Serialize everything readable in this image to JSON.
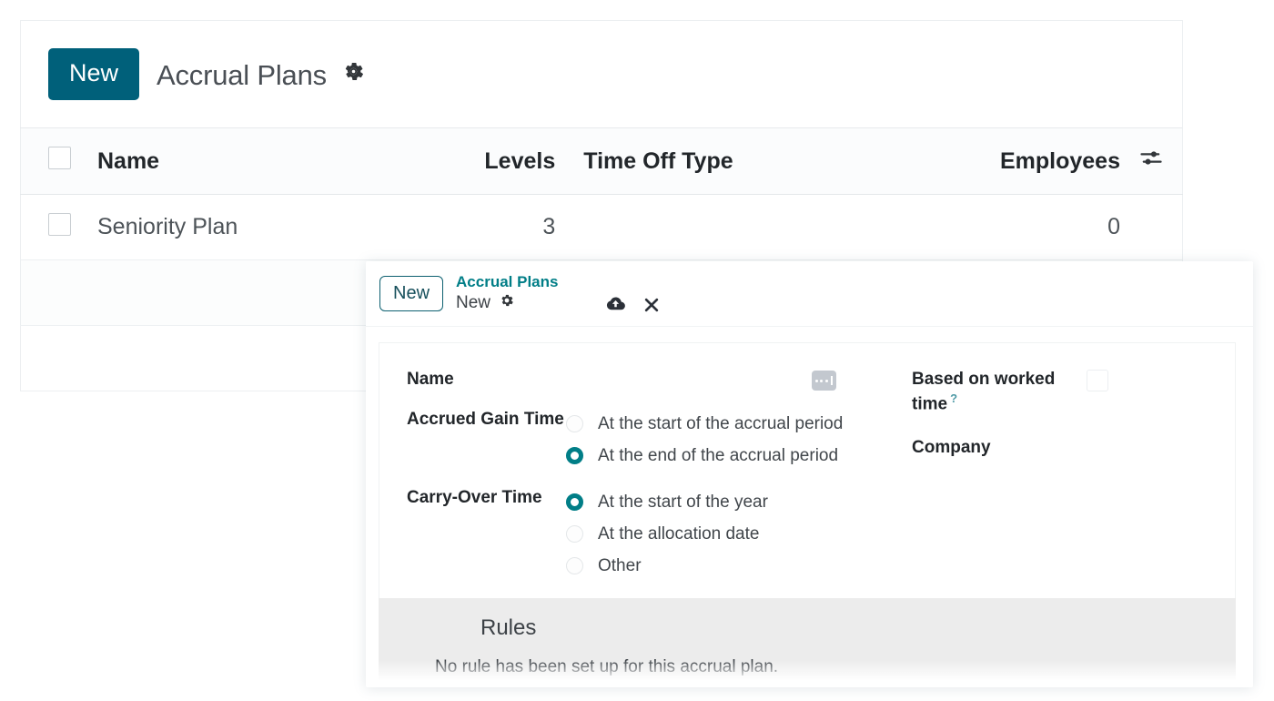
{
  "list_view": {
    "new_button_label": "New",
    "page_title": "Accrual Plans",
    "title_gear_icon": "gear-icon",
    "table": {
      "columns": [
        "Name",
        "Levels",
        "Time Off Type",
        "Employees"
      ],
      "settings_icon": "sliders-icon",
      "rows": [
        {
          "name": "Seniority Plan",
          "levels": "3",
          "time_off_type": "",
          "employees": "0"
        },
        {
          "name": "",
          "levels": "",
          "time_off_type": "",
          "employees": ""
        },
        {
          "name": "",
          "levels": "",
          "time_off_type": "",
          "employees": ""
        }
      ]
    }
  },
  "dialog": {
    "new_button_label": "New",
    "breadcrumb_root": "Accrual Plans",
    "breadcrumb_current": "New",
    "breadcrumb_gear_icon": "gear-icon",
    "save_icon": "cloud-upload-icon",
    "discard_icon": "close-icon",
    "form": {
      "name_label": "Name",
      "name_value": "",
      "name_placeholder_icon": "dots-placeholder-icon",
      "accrued_gain_time_label": "Accrued Gain Time",
      "accrued_gain_options": [
        {
          "label": "At the start of the accrual period",
          "selected": false
        },
        {
          "label": "At the end of the accrual period",
          "selected": true
        }
      ],
      "carry_over_time_label": "Carry-Over Time",
      "carry_over_options": [
        {
          "label": "At the start of the year",
          "selected": true
        },
        {
          "label": "At the allocation date",
          "selected": false
        },
        {
          "label": "Other",
          "selected": false
        }
      ],
      "based_on_worked_time_label": "Based on worked time",
      "based_on_worked_time_help": "?",
      "based_on_worked_time_checked": false,
      "company_label": "Company",
      "company_value": ""
    },
    "rules": {
      "title": "Rules",
      "empty_message": "No rule has been set up for this accrual plan."
    }
  },
  "colors": {
    "primary_button": "#00607a",
    "accent_teal": "#017e87",
    "rules_band": "#ececec",
    "text_dark": "#22262a",
    "border_light": "#eceff1"
  }
}
